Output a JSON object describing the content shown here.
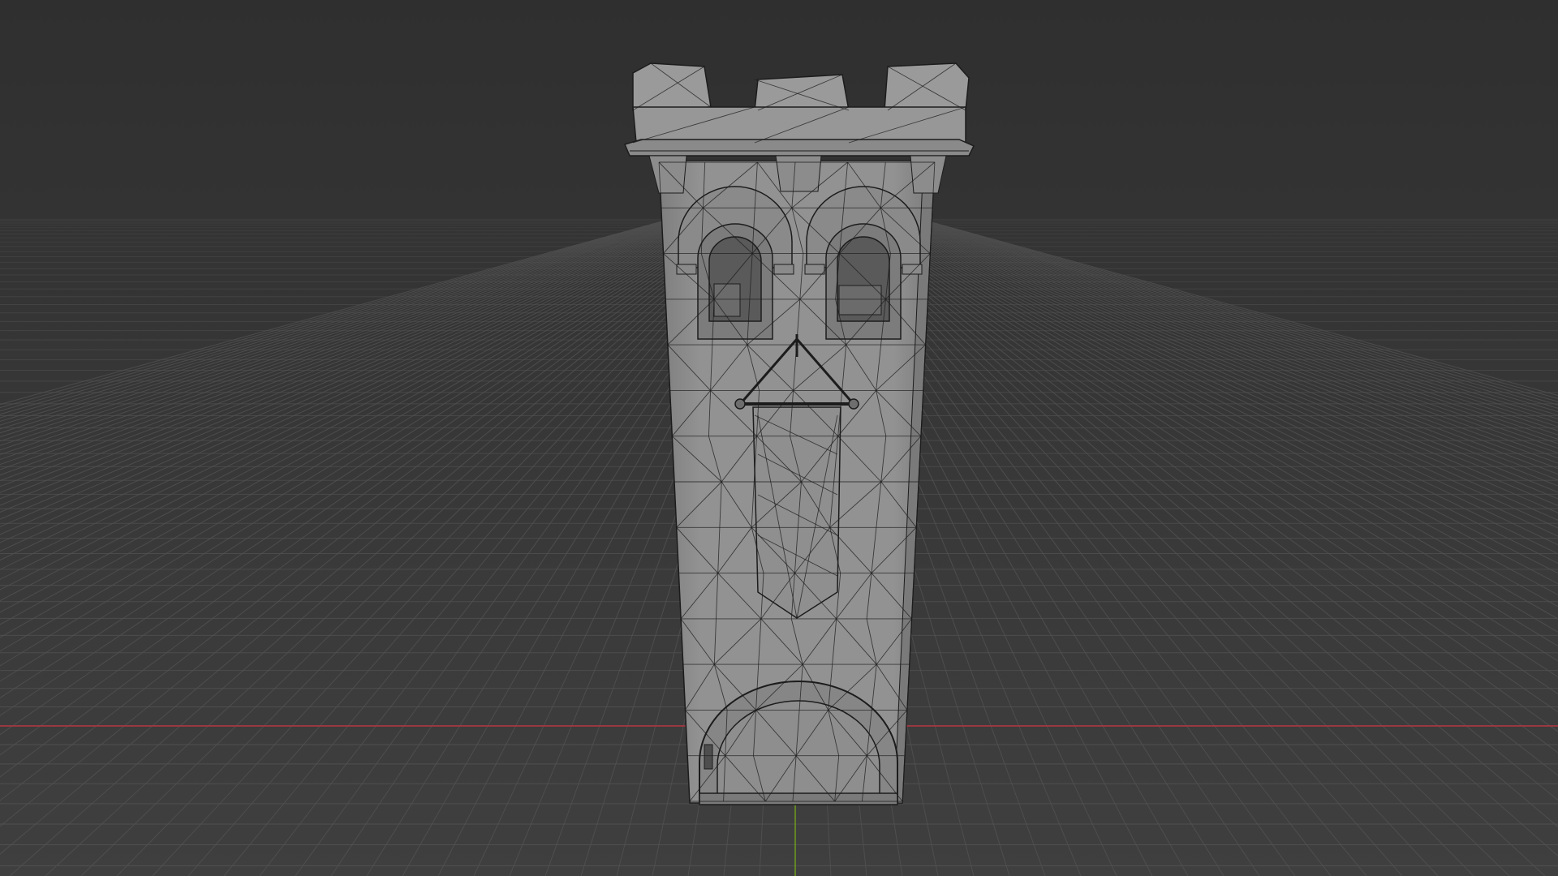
{
  "viewport": {
    "mode": "wireframe",
    "background_color": "#3d3d3d",
    "horizon_color": "#2e2e2e",
    "grid_color": "#515151",
    "x_axis_color": "#b2343f",
    "y_axis_color": "#6f9a1e"
  },
  "model": {
    "object": "castle-tower",
    "face_color": "#8d8d8d",
    "face_light_color": "#9a9a9a",
    "edge_color": "#1c1c1c"
  }
}
